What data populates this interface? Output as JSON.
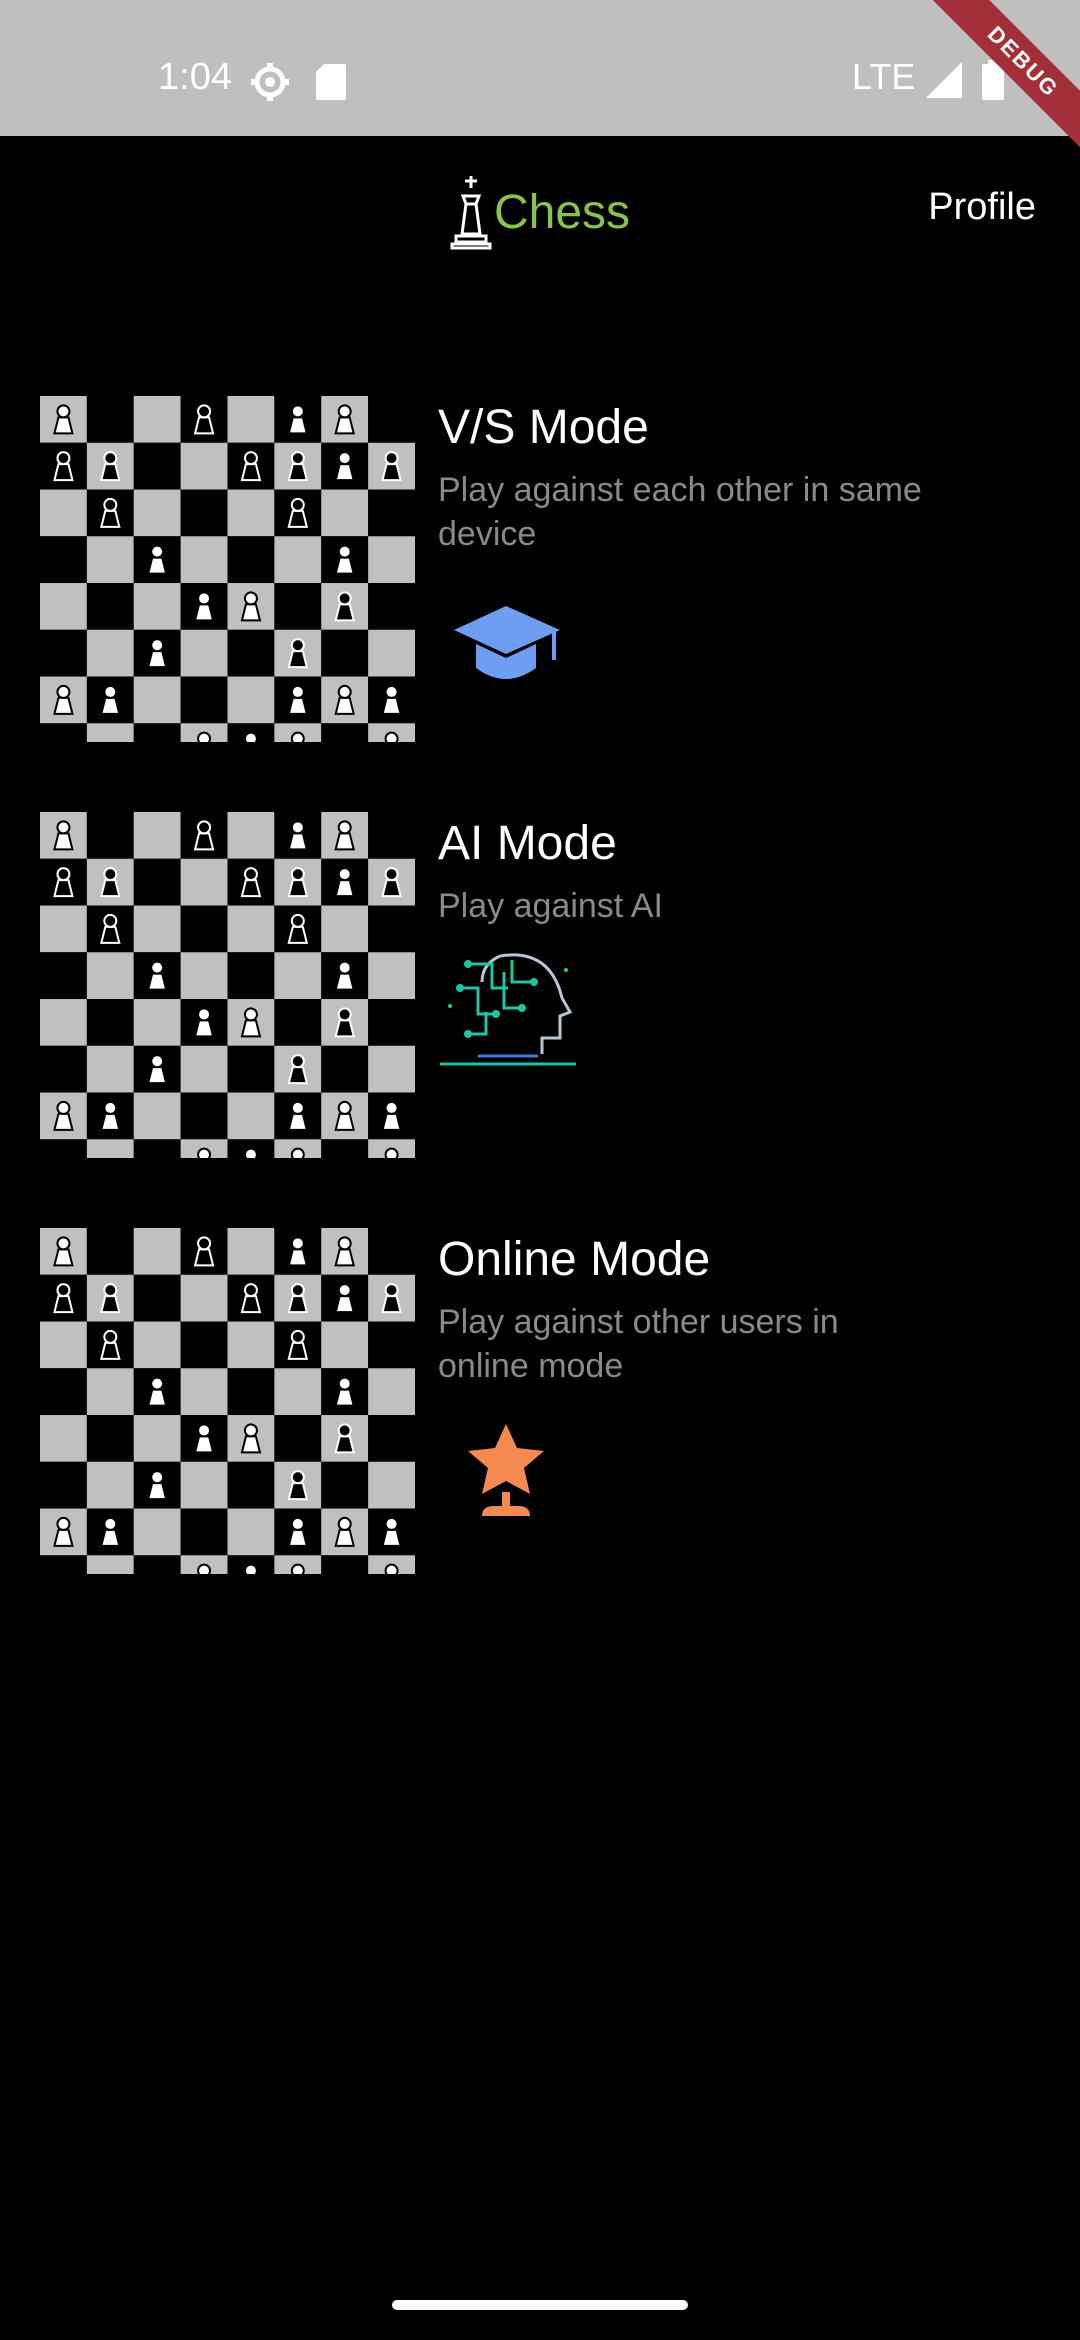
{
  "status_bar": {
    "time": "1:04",
    "network": "LTE",
    "debug_label": "DEBUG"
  },
  "app_bar": {
    "title": "Chess",
    "profile_label": "Profile"
  },
  "modes": [
    {
      "title": "V/S Mode",
      "description": "Play against each other in same device",
      "icon": "graduation-cap-icon",
      "icon_color": "#6e9ef2"
    },
    {
      "title": "AI Mode",
      "description": "Play against AI",
      "icon": "ai-head-circuit-icon",
      "icon_color": "#21c5a5"
    },
    {
      "title": "Online Mode",
      "description": "Play against other users in online mode",
      "icon": "star-trophy-icon",
      "icon_color": "#f58a50"
    }
  ],
  "colors": {
    "title_green": "#8bc34a",
    "desc_gray": "#8a8a8a",
    "board_light": "#c0c0c0",
    "board_dark": "#000000"
  }
}
